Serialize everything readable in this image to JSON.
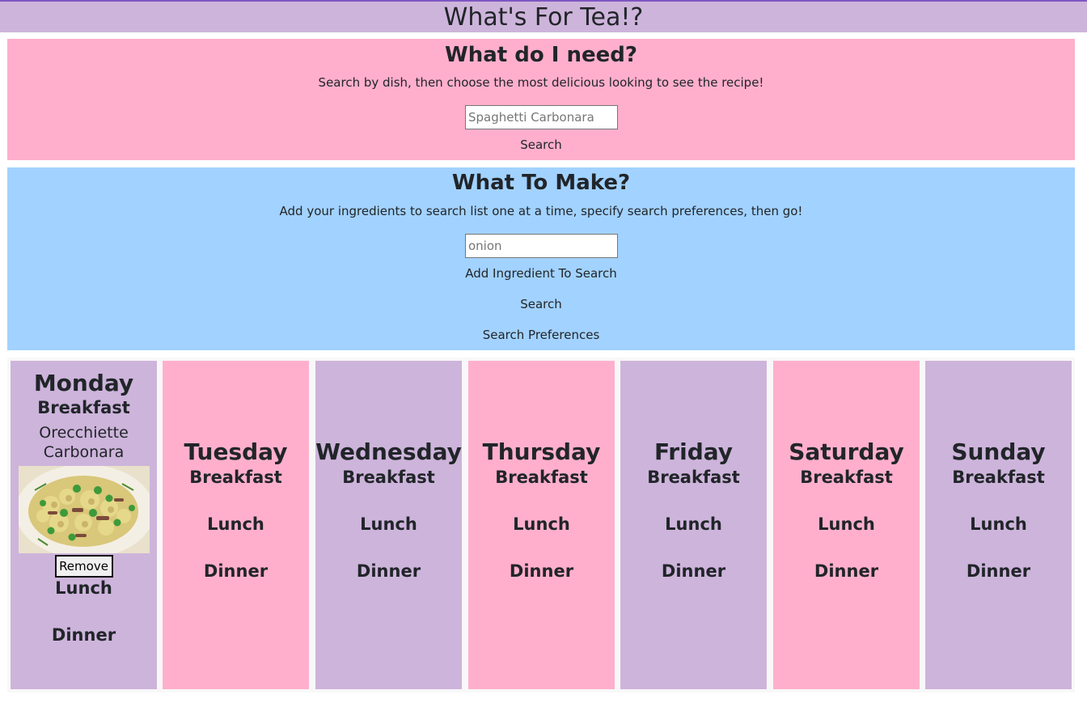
{
  "app": {
    "title": "What's For Tea!?"
  },
  "need": {
    "heading": "What do I need?",
    "description": "Search by dish, then choose the most delicious looking to see the recipe!",
    "placeholder": "Spaghetti Carbonara",
    "search_label": "Search"
  },
  "make": {
    "heading": "What To Make?",
    "description": "Add your ingredients to search list one at a time, specify search preferences, then go!",
    "placeholder": "onion",
    "add_label": "Add Ingredient To Search",
    "search_label": "Search",
    "prefs_label": "Search Preferences"
  },
  "planner": {
    "meals": [
      "Breakfast",
      "Lunch",
      "Dinner"
    ],
    "days": [
      {
        "name": "Monday",
        "color": "#cdb4db",
        "breakfast_recipe": {
          "name": "Orecchiette Carbonara",
          "remove_label": "Remove"
        }
      },
      {
        "name": "Tuesday",
        "color": "#ffafcc"
      },
      {
        "name": "Wednesday",
        "color": "#cdb4db"
      },
      {
        "name": "Thursday",
        "color": "#ffafcc"
      },
      {
        "name": "Friday",
        "color": "#cdb4db"
      },
      {
        "name": "Saturday",
        "color": "#ffafcc"
      },
      {
        "name": "Sunday",
        "color": "#cdb4db"
      }
    ]
  },
  "colors": {
    "lavender": "#cdb4db",
    "pink": "#ffafcc",
    "blue": "#a2d2ff",
    "top_border": "#7e57c2"
  }
}
